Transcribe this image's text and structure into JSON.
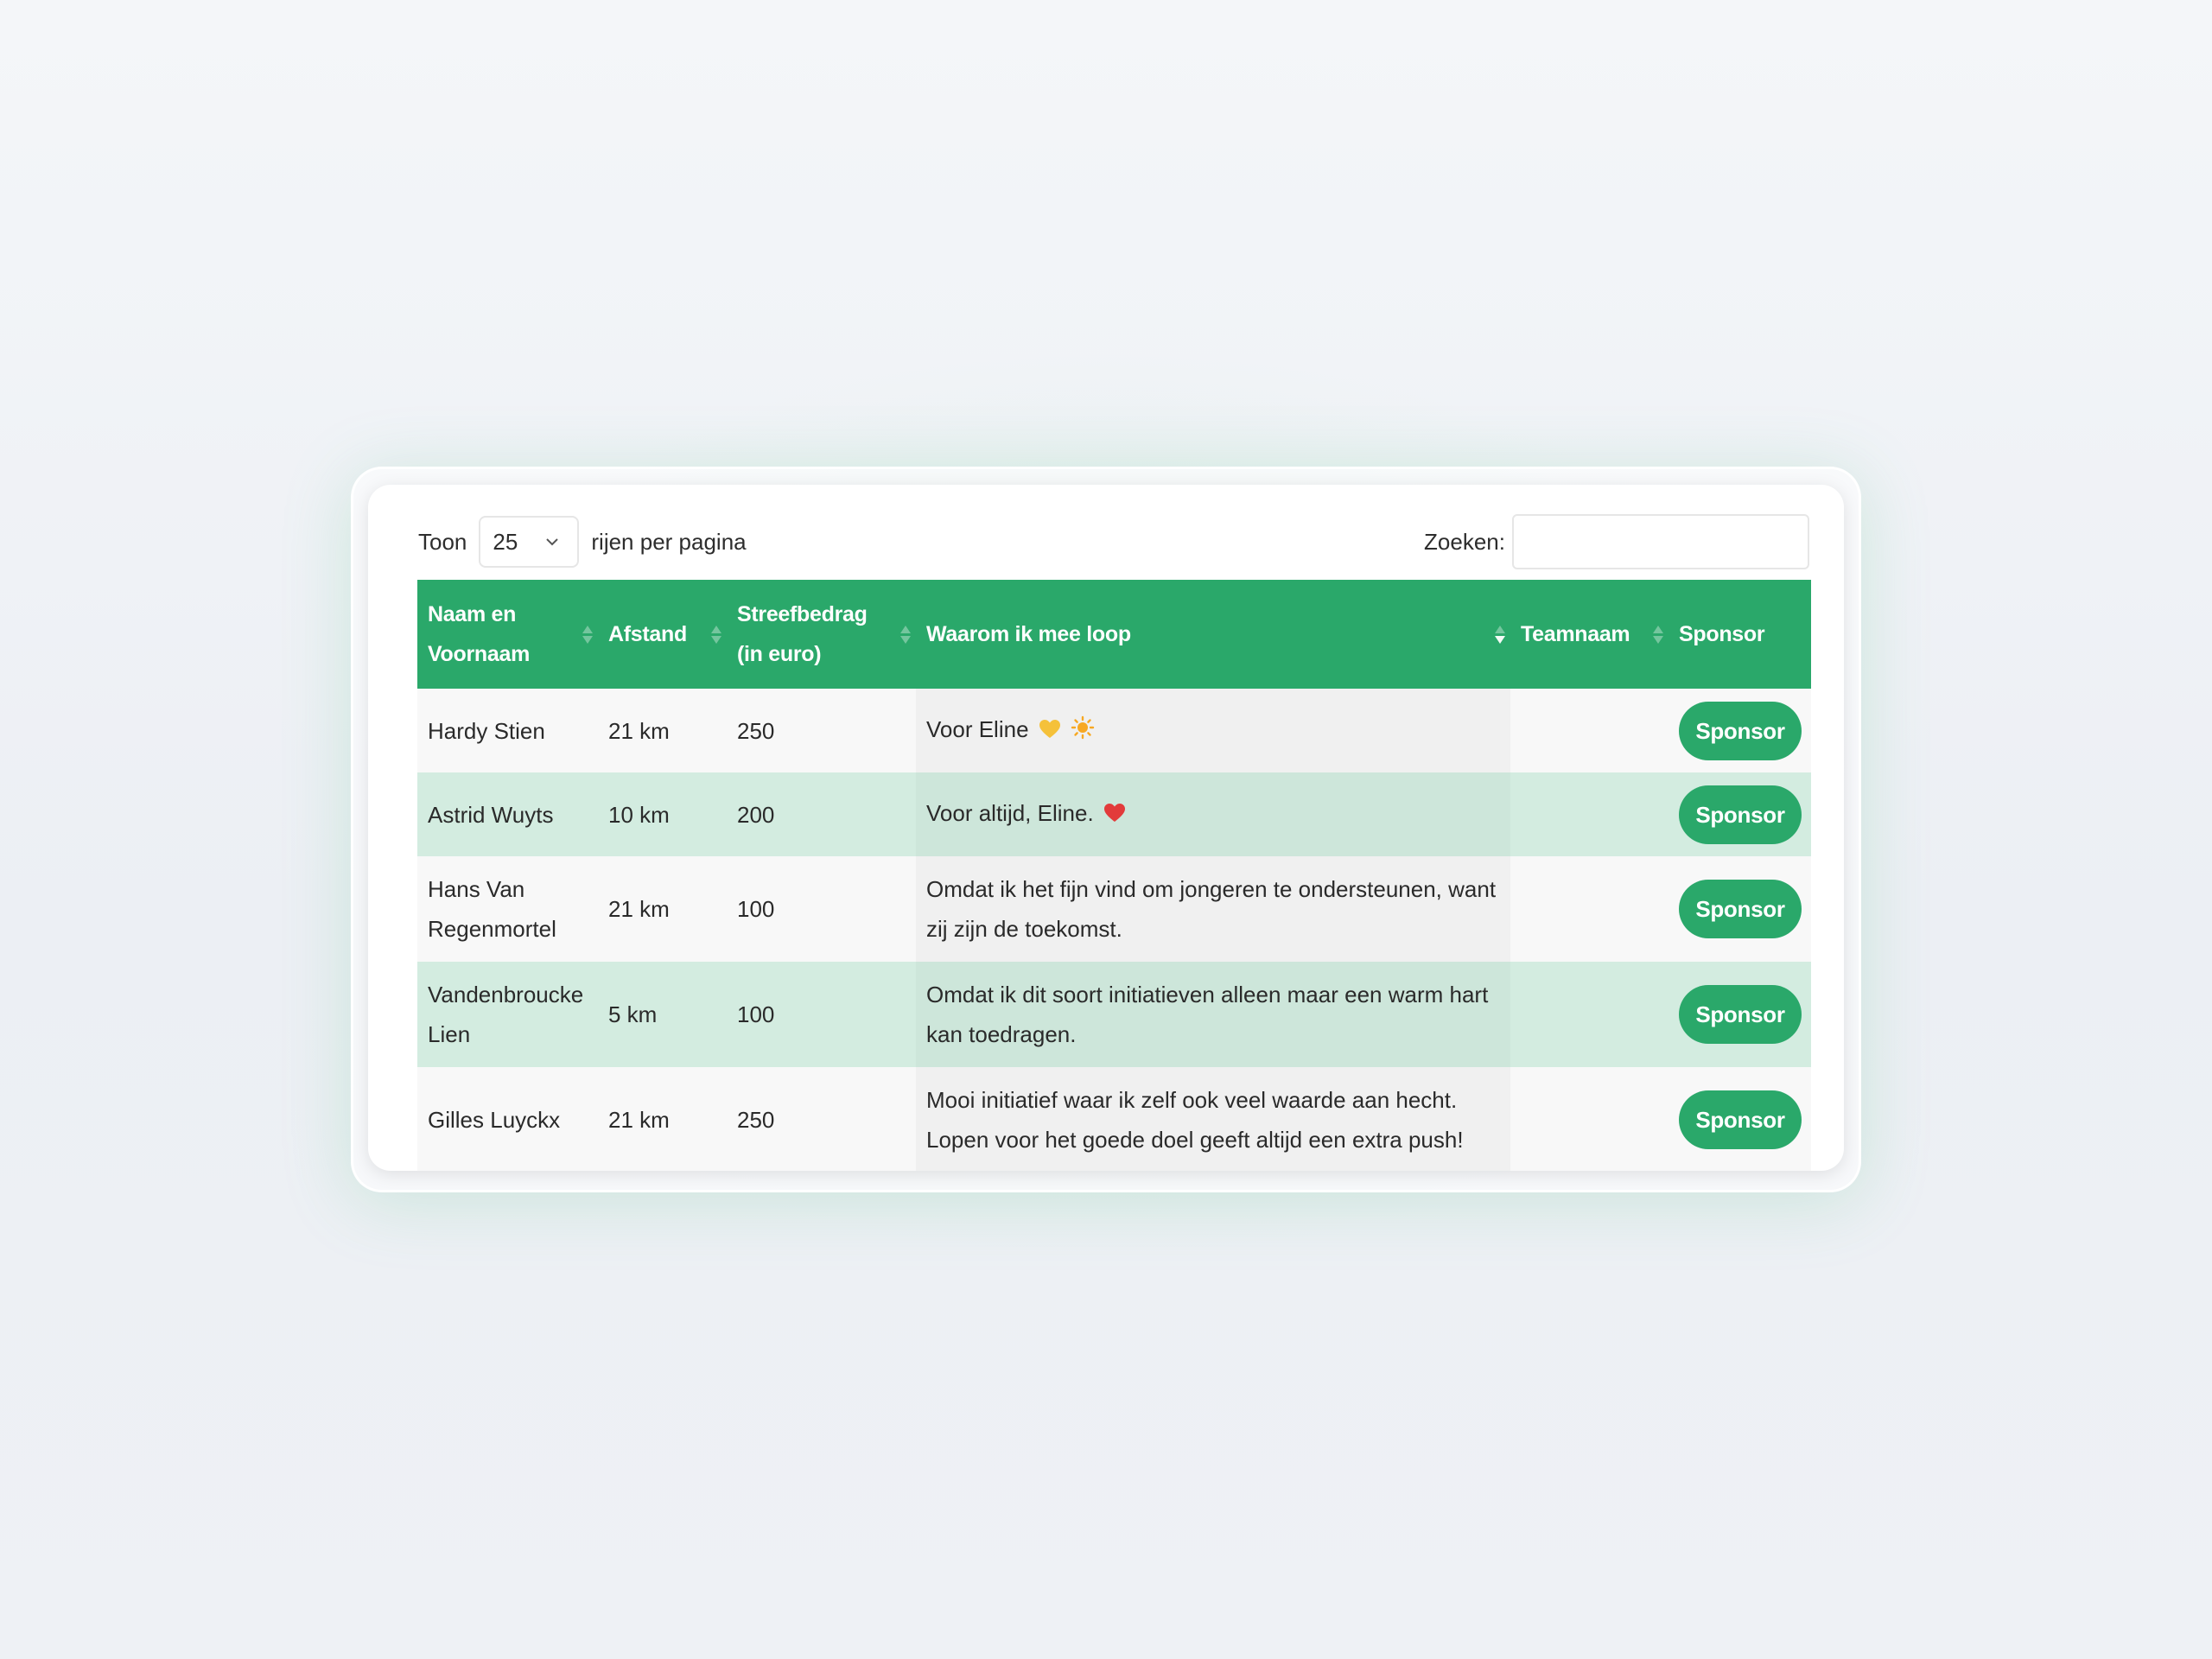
{
  "controls": {
    "show_label": "Toon",
    "page_size": "25",
    "rows_label": "rijen per pagina",
    "search_label": "Zoeken:",
    "search_value": ""
  },
  "columns": [
    "Naam en Voornaam",
    "Afstand",
    "Streefbedrag (in euro)",
    "Waarom ik mee loop",
    "Teamnaam",
    "Sponsor"
  ],
  "rows": [
    {
      "name": "Hardy Stien",
      "distance": "21 km",
      "target": "250",
      "reason": "Voor Eline",
      "team": "",
      "button": "Sponsor"
    },
    {
      "name": "Astrid Wuyts",
      "distance": "10 km",
      "target": "200",
      "reason": "Voor altijd, Eline.",
      "team": "",
      "button": "Sponsor"
    },
    {
      "name": "Hans Van Regenmortel",
      "distance": "21 km",
      "target": "100",
      "reason": "Omdat ik het fijn vind om jongeren te ondersteunen, want zij zijn de toekomst.",
      "team": "",
      "button": "Sponsor"
    },
    {
      "name": "Vandenbroucke Lien",
      "distance": "5 km",
      "target": "100",
      "reason": "Omdat ik dit soort initiatieven alleen maar een warm hart kan toedragen.",
      "team": "",
      "button": "Sponsor"
    },
    {
      "name": "Gilles Luyckx",
      "distance": "21 km",
      "target": "250",
      "reason": "Mooi initiatief waar ik zelf ook veel waarde aan hecht. Lopen voor het goede doel geeft altijd een extra push!",
      "team": "",
      "button": "Sponsor"
    }
  ],
  "colors": {
    "accent": "#2aa86a",
    "row_alt": "#d3ece0",
    "heart_yellow": "#f5c13a",
    "sun": "#f7a823",
    "heart_red": "#e23b3b"
  },
  "sorted_column": "Waarom ik mee loop",
  "sort_direction": "descending"
}
